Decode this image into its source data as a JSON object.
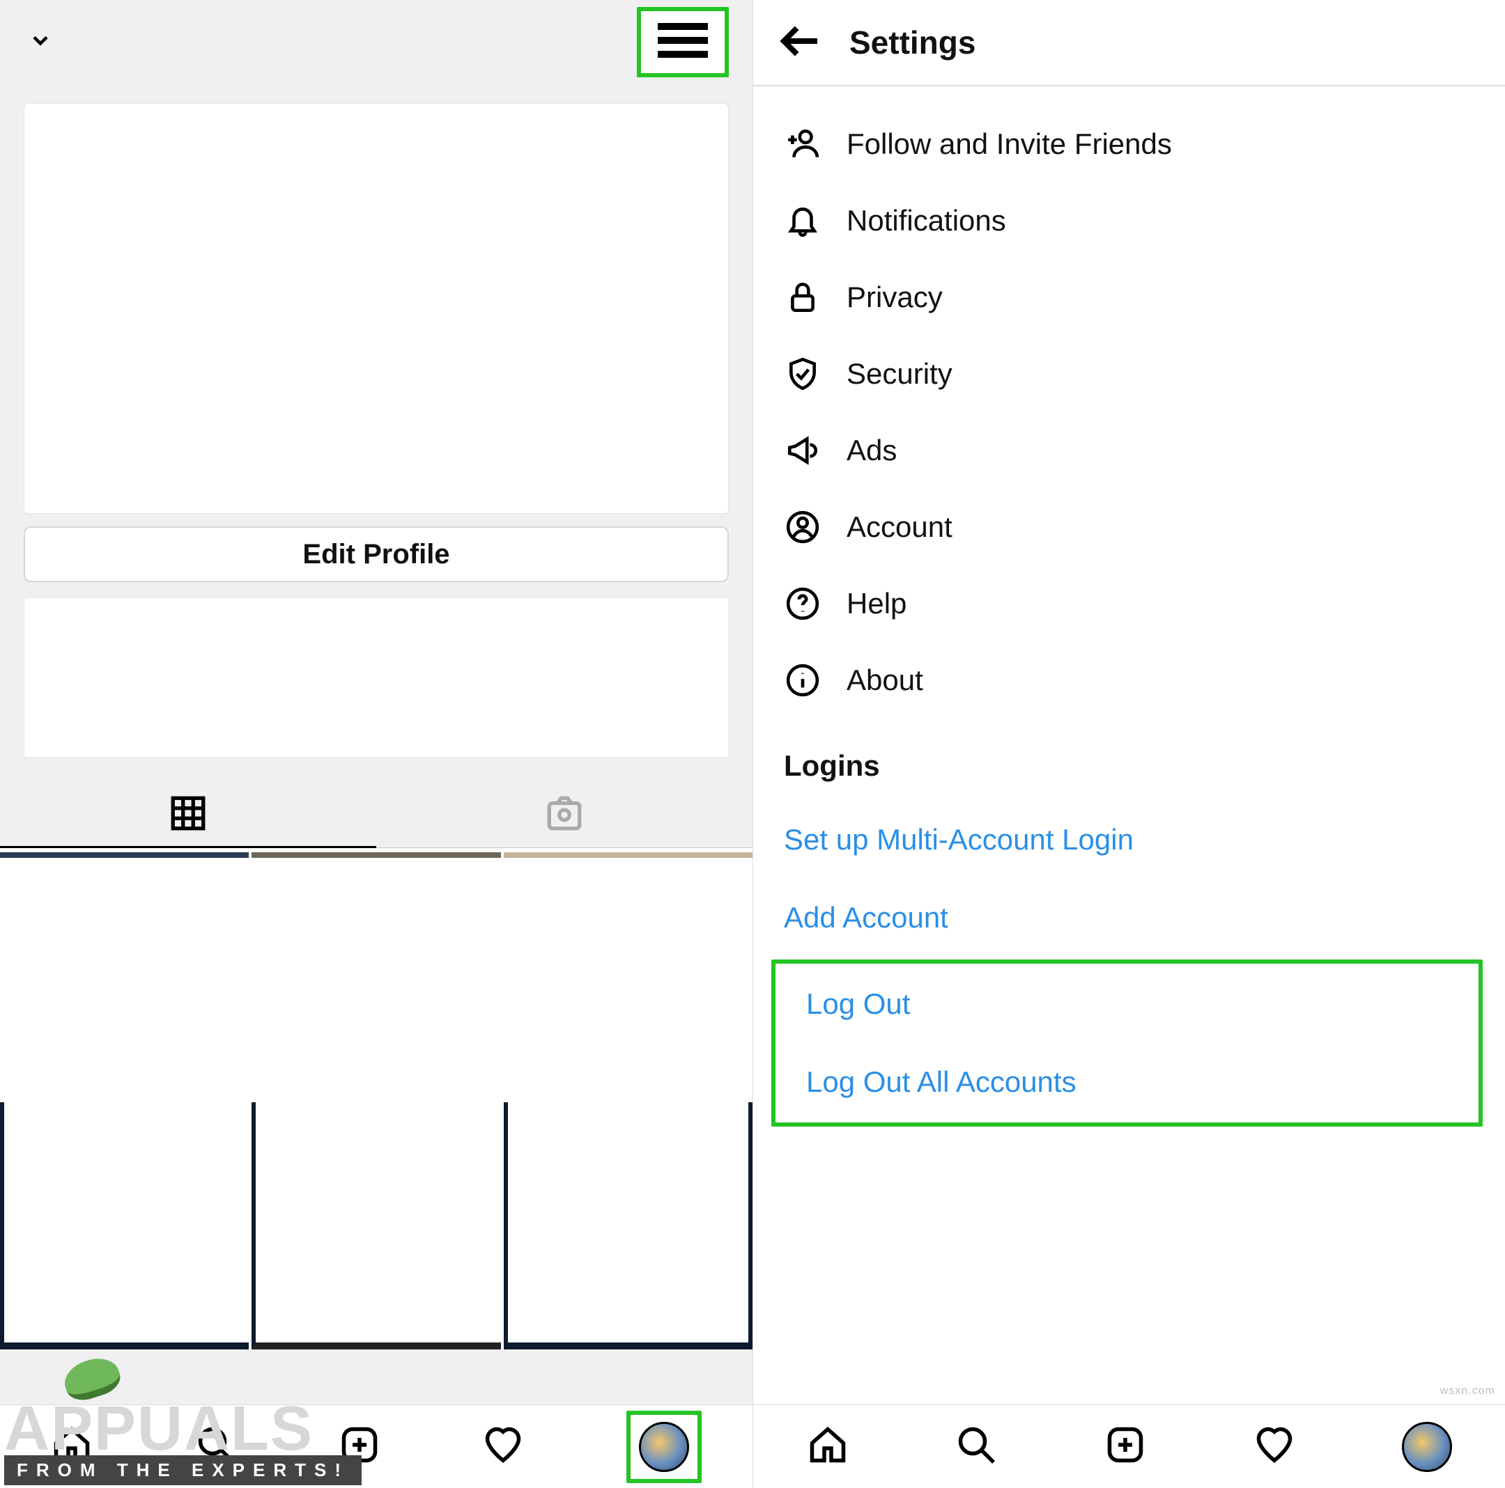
{
  "left": {
    "edit_profile_label": "Edit Profile"
  },
  "right": {
    "title": "Settings",
    "items": [
      {
        "label": "Follow and Invite Friends"
      },
      {
        "label": "Notifications"
      },
      {
        "label": "Privacy"
      },
      {
        "label": "Security"
      },
      {
        "label": "Ads"
      },
      {
        "label": "Account"
      },
      {
        "label": "Help"
      },
      {
        "label": "About"
      }
    ],
    "logins_header": "Logins",
    "links": {
      "multi_account": "Set up Multi-Account Login",
      "add_account": "Add Account",
      "log_out": "Log Out",
      "log_out_all": "Log Out All Accounts"
    }
  },
  "watermark": {
    "brand": "APPUALS",
    "tagline": "FROM THE EXPERTS!"
  },
  "attribution": "wsxn.com"
}
